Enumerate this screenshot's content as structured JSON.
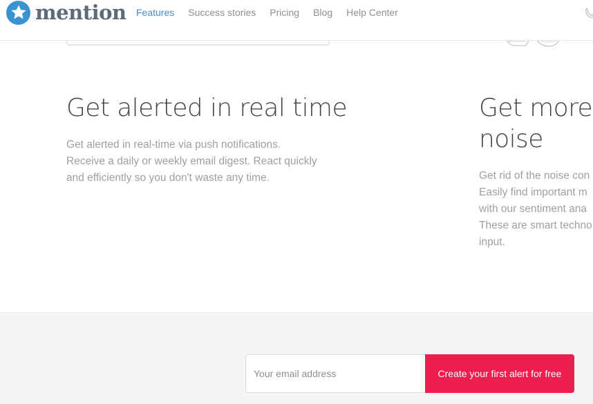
{
  "brand": {
    "name": "mention",
    "color": "#3a93d0"
  },
  "nav": {
    "items": [
      {
        "label": "Features",
        "active": true
      },
      {
        "label": "Success stories",
        "active": false
      },
      {
        "label": "Pricing",
        "active": false
      },
      {
        "label": "Blog",
        "active": false
      },
      {
        "label": "Help Center",
        "active": false
      }
    ],
    "active_color": "#3b8fd2"
  },
  "features": [
    {
      "title": "Get alerted in real time",
      "body_lines": [
        "Get alerted in real-time via push notifications.",
        "Receive a daily or weekly email digest. React quickly",
        "and efficiently so you don't waste any time."
      ]
    },
    {
      "title_lines": [
        "Get more s",
        "noise"
      ],
      "body_lines": [
        "Get rid of the noise con",
        "Easily find important m",
        "with our sentiment ana",
        "These are smart techno",
        "input."
      ]
    }
  ],
  "signup": {
    "email_placeholder": "Your email address",
    "email_value": "",
    "cta_label": "Create your first alert for free",
    "cta_color": "#ee1f4e"
  },
  "icons": {
    "logo": "star-icon",
    "phone": "phone-icon",
    "devices": "device-sketch-icon"
  }
}
